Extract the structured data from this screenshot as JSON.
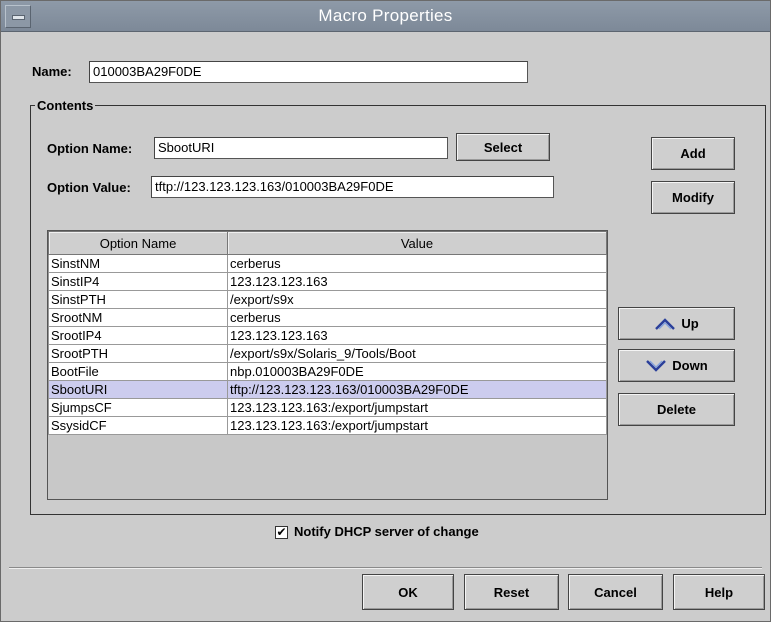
{
  "window": {
    "title": "Macro Properties"
  },
  "name": {
    "label": "Name:",
    "mnemonic": "N",
    "value": "010003BA29F0DE"
  },
  "contents": {
    "legend": "Contents",
    "option_name": {
      "label": "Option Name:",
      "value": "SbootURI"
    },
    "option_value": {
      "label": "Option Value:",
      "value": "tftp://123.123.123.163/010003BA29F0DE"
    },
    "select_button": "Select",
    "add_button": "Add",
    "modify_button": "Modify",
    "up_button": "Up",
    "down_button": "Down",
    "delete_button": "Delete",
    "table": {
      "columns": [
        "Option Name",
        "Value"
      ],
      "rows": [
        [
          "SinstNM",
          "cerberus"
        ],
        [
          "SinstIP4",
          "123.123.123.163"
        ],
        [
          "SinstPTH",
          "/export/s9x"
        ],
        [
          "SrootNM",
          "cerberus"
        ],
        [
          "SrootIP4",
          "123.123.123.163"
        ],
        [
          "SrootPTH",
          "/export/s9x/Solaris_9/Tools/Boot"
        ],
        [
          "BootFile",
          "nbp.010003BA29F0DE"
        ],
        [
          "SbootURI",
          "tftp://123.123.123.163/010003BA29F0DE"
        ],
        [
          "SjumpsCF",
          "123.123.123.163:/export/jumpstart"
        ],
        [
          "SsysidCF",
          "123.123.123.163:/export/jumpstart"
        ]
      ],
      "selected_row": 7
    }
  },
  "notify": {
    "label": "Notify DHCP server of change",
    "checked": true,
    "check_glyph": "✔"
  },
  "footer": {
    "ok": "OK",
    "reset": "Reset",
    "cancel": "Cancel",
    "help": "Help"
  },
  "icons": {
    "up": "up-chevron-icon",
    "down": "down-chevron-icon",
    "menu": "window-menu-icon"
  }
}
